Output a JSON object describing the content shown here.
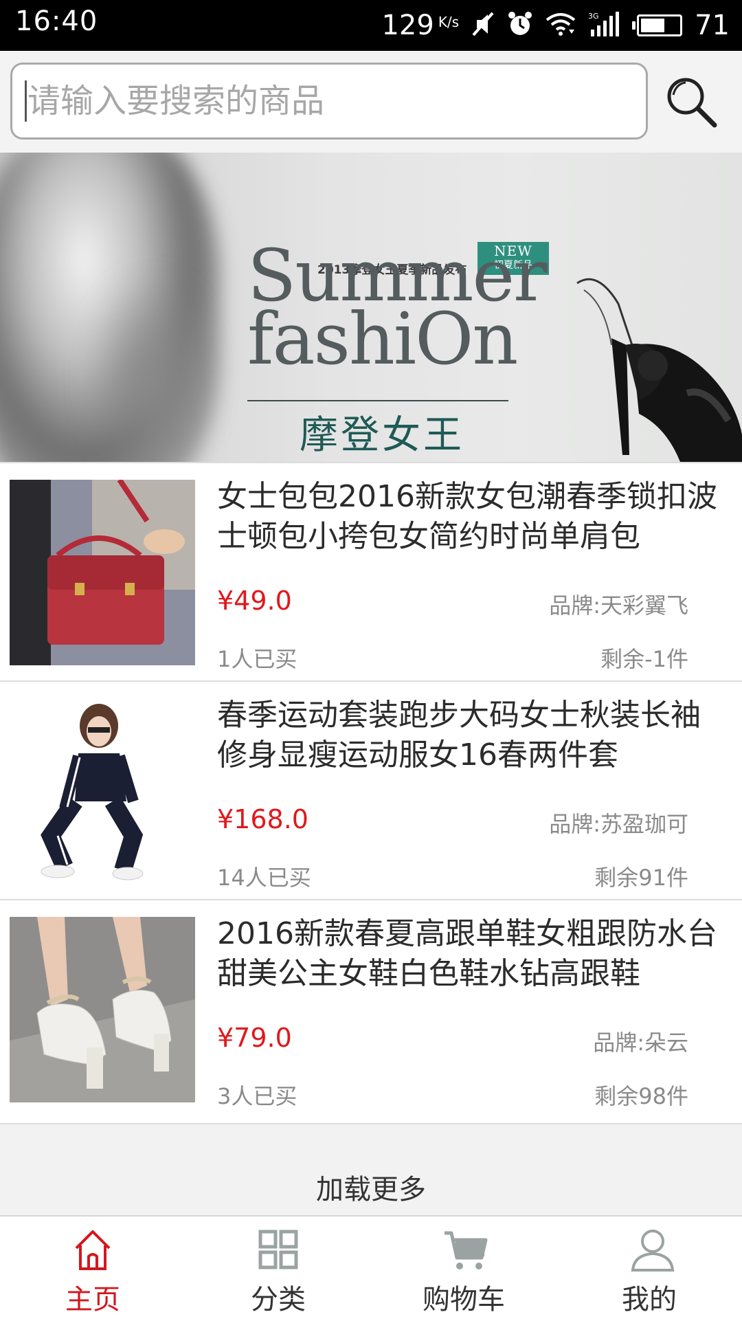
{
  "status_bar": {
    "time": "16:40",
    "speed": "129",
    "speed_unit": "K/s",
    "battery_level": "71",
    "network": "3G"
  },
  "search": {
    "placeholder": "请输入要搜索的商品"
  },
  "banner": {
    "top_text": "2013摩登女王夏季新品发布",
    "badge_line1": "NEW",
    "badge_line2": "初夏新品",
    "headline_line1": "Summer",
    "headline_line2": "fashiOn",
    "chinese_title": "摩登女王"
  },
  "products": [
    {
      "title": "女士包包2016新款女包潮春季锁扣波士顿包小挎包女简约时尚单肩包",
      "price": "¥49.0",
      "brand": "品牌:天彩翼飞",
      "sold": "1人已买",
      "stock": "剩余-1件"
    },
    {
      "title": "春季运动套装跑步大码女士秋装长袖修身显瘦运动服女16春两件套",
      "price": "¥168.0",
      "brand": "品牌:苏盈珈可",
      "sold": "14人已买",
      "stock": "剩余91件"
    },
    {
      "title": "2016新款春夏高跟单鞋女粗跟防水台甜美公主女鞋白色鞋水钻高跟鞋",
      "price": "¥79.0",
      "brand": "品牌:朵云",
      "sold": "3人已买",
      "stock": "剩余98件"
    }
  ],
  "load_more": "加载更多",
  "bottom_nav": [
    {
      "label": "主页",
      "icon": "home-icon",
      "active": true
    },
    {
      "label": "分类",
      "icon": "grid-icon",
      "active": false
    },
    {
      "label": "购物车",
      "icon": "cart-icon",
      "active": false
    },
    {
      "label": "我的",
      "icon": "user-icon",
      "active": false
    }
  ],
  "colors": {
    "accent_red": "#d4161c",
    "price_red": "#e0181c",
    "icon_gray": "#9aa3a2"
  }
}
